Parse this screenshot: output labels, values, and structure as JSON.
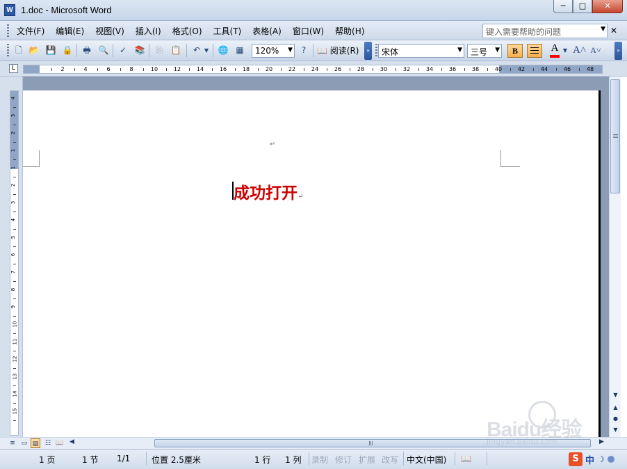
{
  "window": {
    "title": "1.doc - Microsoft Word",
    "app_icon_letter": "W",
    "controls": {
      "minimize": "─",
      "maximize": "□",
      "close": "✕"
    }
  },
  "menu": {
    "items": [
      "文件(F)",
      "编辑(E)",
      "视图(V)",
      "插入(I)",
      "格式(O)",
      "工具(T)",
      "表格(A)",
      "窗口(W)",
      "帮助(H)"
    ],
    "help_placeholder": "键入需要帮助的问题",
    "close_doc": "✕"
  },
  "toolbar": {
    "zoom": "120%",
    "read_label": "阅读(R)",
    "font_name": "宋体",
    "font_size": "三号",
    "bold_label": "B",
    "font_color_label": "A",
    "font_color": "#ff0000",
    "grow_font_label": "A",
    "shrink_font_label": "A"
  },
  "ruler": {
    "numbers": [
      "2",
      "4",
      "6",
      "8",
      "10",
      "12",
      "14",
      "16",
      "18",
      "20",
      "22",
      "24",
      "26",
      "28",
      "30",
      "32",
      "34",
      "36",
      "38",
      "40",
      "42",
      "44",
      "46",
      "48"
    ],
    "vertical_numbers": [
      "4",
      "3",
      "2",
      "1",
      "1",
      "2",
      "3",
      "4",
      "5",
      "6",
      "7",
      "8",
      "9",
      "10",
      "11",
      "12",
      "13",
      "14",
      "15"
    ],
    "tab_selector": "L"
  },
  "document": {
    "body_text": "成功打开",
    "text_color": "#cc0000",
    "paragraph_mark": "↵"
  },
  "statusbar": {
    "page": "1 页",
    "section": "1 节",
    "page_of": "1/1",
    "position": "位置 2.5厘米",
    "line": "1 行",
    "column": "1 列",
    "rec": "录制",
    "trk": "修订",
    "ext": "扩展",
    "ovr": "改写",
    "language": "中文(中国)",
    "ime_logo": "S",
    "ime_mode": "中"
  },
  "watermark": {
    "brand": "Baidu经验",
    "url": "jingyan.baidu.com"
  }
}
